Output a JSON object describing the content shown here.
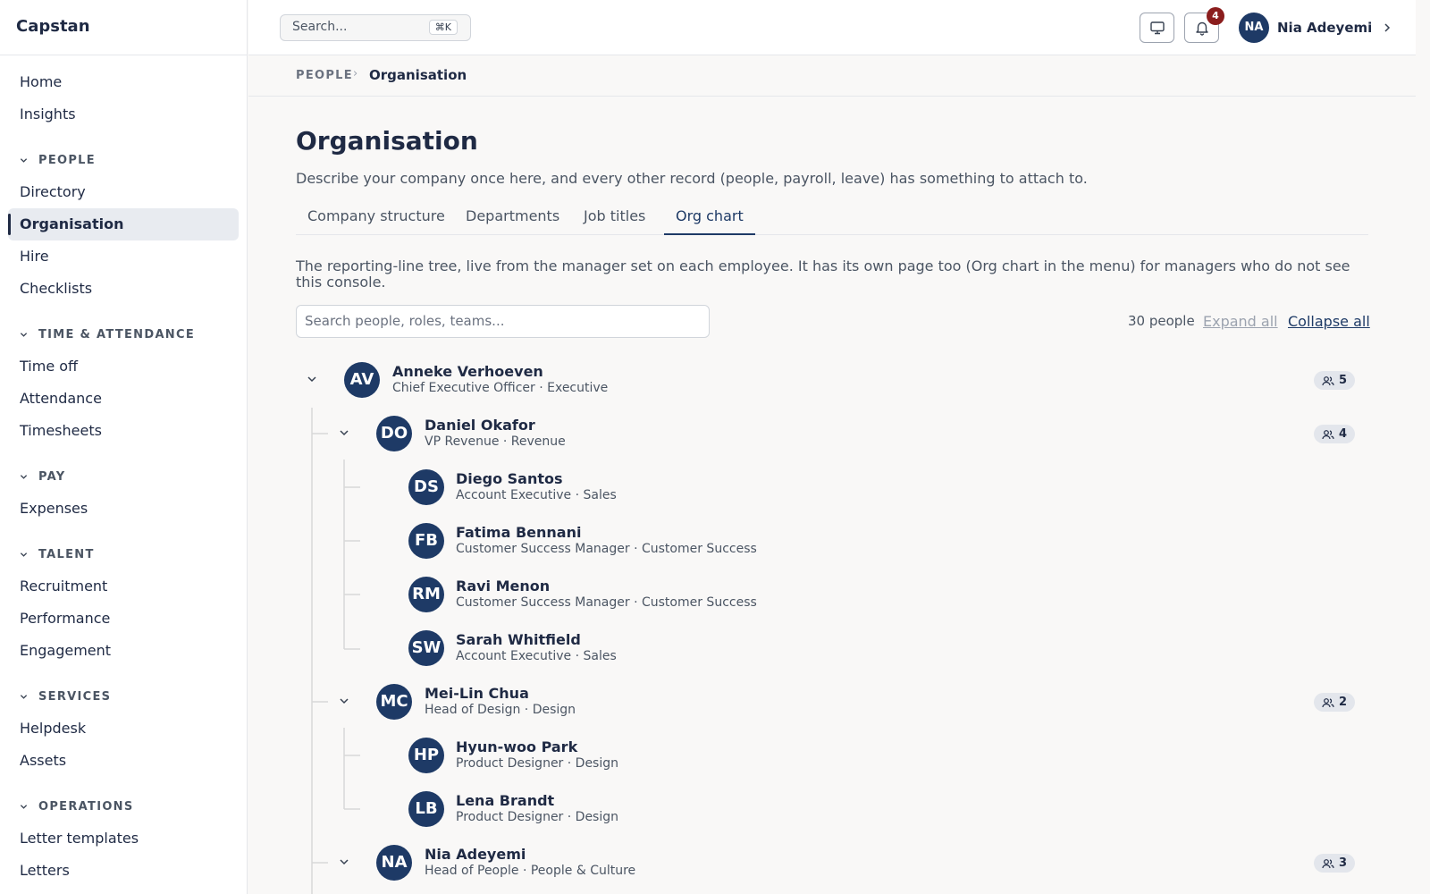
{
  "app": {
    "name": "Capstan"
  },
  "sidebar": {
    "top_items": [
      {
        "label": "Home"
      },
      {
        "label": "Insights"
      }
    ],
    "sections": [
      {
        "title": "PEOPLE",
        "items": [
          {
            "label": "Directory"
          },
          {
            "label": "Organisation",
            "active": true
          },
          {
            "label": "Hire"
          },
          {
            "label": "Checklists"
          }
        ]
      },
      {
        "title": "TIME & ATTENDANCE",
        "items": [
          {
            "label": "Time off"
          },
          {
            "label": "Attendance"
          },
          {
            "label": "Timesheets"
          }
        ]
      },
      {
        "title": "PAY",
        "items": [
          {
            "label": "Expenses"
          }
        ]
      },
      {
        "title": "TALENT",
        "items": [
          {
            "label": "Recruitment"
          },
          {
            "label": "Performance"
          },
          {
            "label": "Engagement"
          }
        ]
      },
      {
        "title": "SERVICES",
        "items": [
          {
            "label": "Helpdesk"
          },
          {
            "label": "Assets"
          }
        ]
      },
      {
        "title": "OPERATIONS",
        "items": [
          {
            "label": "Letter templates"
          },
          {
            "label": "Letters"
          }
        ]
      }
    ]
  },
  "topbar": {
    "search_placeholder": "Search...",
    "search_shortcut": "⌘K",
    "notifications_count": "4",
    "user": {
      "initials": "NA",
      "name": "Nia Adeyemi"
    }
  },
  "breadcrumb": {
    "section": "PEOPLE",
    "current": "Organisation"
  },
  "page": {
    "title": "Organisation",
    "description": "Describe your company once here, and every other record (people, payroll, leave) has something to attach to.",
    "tabs": [
      {
        "label": "Company structure"
      },
      {
        "label": "Departments"
      },
      {
        "label": "Job titles"
      },
      {
        "label": "Org chart",
        "active": true
      }
    ]
  },
  "org_chart": {
    "intro": "The reporting-line tree, live from the manager set on each employee. It has its own page too (Org chart in the menu) for managers who do not see this console.",
    "search_placeholder": "Search people, roles, teams...",
    "count_label": "30 people",
    "expand_all": "Expand all",
    "collapse_all": "Collapse all",
    "nodes": [
      {
        "initials": "AV",
        "name": "Anneke Verhoeven",
        "role": "Chief Executive Officer · Executive",
        "reports": "5",
        "level": 0
      },
      {
        "initials": "DO",
        "name": "Daniel Okafor",
        "role": "VP Revenue · Revenue",
        "reports": "4",
        "level": 1
      },
      {
        "initials": "DS",
        "name": "Diego Santos",
        "role": "Account Executive · Sales",
        "level": 2
      },
      {
        "initials": "FB",
        "name": "Fatima Bennani",
        "role": "Customer Success Manager · Customer Success",
        "level": 2
      },
      {
        "initials": "RM",
        "name": "Ravi Menon",
        "role": "Customer Success Manager · Customer Success",
        "level": 2
      },
      {
        "initials": "SW",
        "name": "Sarah Whitfield",
        "role": "Account Executive · Sales",
        "level": 2
      },
      {
        "initials": "MC",
        "name": "Mei-Lin Chua",
        "role": "Head of Design · Design",
        "reports": "2",
        "level": 1
      },
      {
        "initials": "HP",
        "name": "Hyun-woo Park",
        "role": "Product Designer · Design",
        "level": 2
      },
      {
        "initials": "LB",
        "name": "Lena Brandt",
        "role": "Product Designer · Design",
        "level": 2
      },
      {
        "initials": "NA",
        "name": "Nia Adeyemi",
        "role": "Head of People · People & Culture",
        "reports": "3",
        "level": 1
      }
    ]
  },
  "colors": {
    "accent": "#1e3a66",
    "badge_bg": "#e3e6ec",
    "notification": "#8b1d1d"
  }
}
